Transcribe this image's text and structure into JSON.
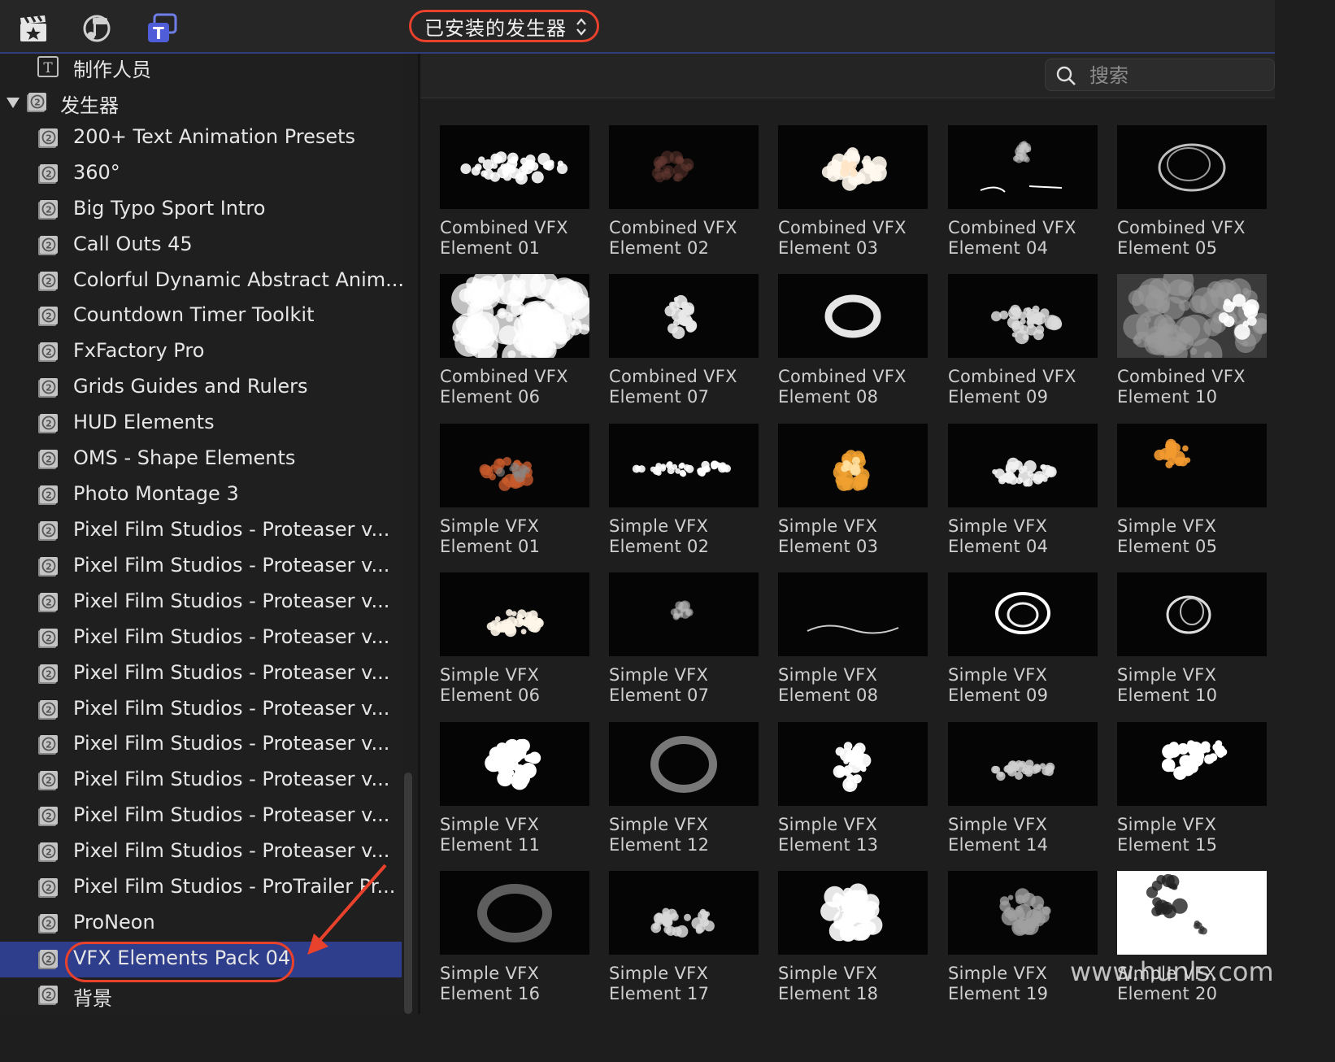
{
  "toolbar": {
    "icons": [
      "clapper-star-icon",
      "music-note-icon",
      "titles-T-icon"
    ],
    "popup_label": "已安装的发生器"
  },
  "sidebar": {
    "items": [
      {
        "label": "制作人员",
        "icon": "text-T-icon",
        "level": 1
      },
      {
        "label": "发生器",
        "icon": "generator-icon",
        "level": 0,
        "expanded": true
      },
      {
        "label": "200+ Text Animation Presets",
        "icon": "generator-icon",
        "level": 1
      },
      {
        "label": "360°",
        "icon": "generator-icon",
        "level": 1
      },
      {
        "label": "Big Typo Sport Intro",
        "icon": "generator-icon",
        "level": 1
      },
      {
        "label": "Call Outs 45",
        "icon": "generator-icon",
        "level": 1
      },
      {
        "label": "Colorful Dynamic Abstract Anim...",
        "icon": "generator-icon",
        "level": 1
      },
      {
        "label": "Countdown Timer Toolkit",
        "icon": "generator-icon",
        "level": 1
      },
      {
        "label": "FxFactory Pro",
        "icon": "generator-icon",
        "level": 1
      },
      {
        "label": "Grids Guides and Rulers",
        "icon": "generator-icon",
        "level": 1
      },
      {
        "label": "HUD Elements",
        "icon": "generator-icon",
        "level": 1
      },
      {
        "label": "OMS - Shape Elements",
        "icon": "generator-icon",
        "level": 1
      },
      {
        "label": "Photo Montage 3",
        "icon": "generator-icon",
        "level": 1
      },
      {
        "label": "Pixel Film Studios - Proteaser v...",
        "icon": "generator-icon",
        "level": 1
      },
      {
        "label": "Pixel Film Studios - Proteaser v...",
        "icon": "generator-icon",
        "level": 1
      },
      {
        "label": "Pixel Film Studios - Proteaser v...",
        "icon": "generator-icon",
        "level": 1
      },
      {
        "label": "Pixel Film Studios - Proteaser v...",
        "icon": "generator-icon",
        "level": 1
      },
      {
        "label": "Pixel Film Studios - Proteaser v...",
        "icon": "generator-icon",
        "level": 1
      },
      {
        "label": "Pixel Film Studios - Proteaser v...",
        "icon": "generator-icon",
        "level": 1
      },
      {
        "label": "Pixel Film Studios - Proteaser v...",
        "icon": "generator-icon",
        "level": 1
      },
      {
        "label": "Pixel Film Studios - Proteaser v...",
        "icon": "generator-icon",
        "level": 1
      },
      {
        "label": "Pixel Film Studios - Proteaser v...",
        "icon": "generator-icon",
        "level": 1
      },
      {
        "label": "Pixel Film Studios - Proteaser v...",
        "icon": "generator-icon",
        "level": 1
      },
      {
        "label": "Pixel Film Studios - ProTrailer Pr...",
        "icon": "generator-icon",
        "level": 1
      },
      {
        "label": "ProNeon",
        "icon": "generator-icon",
        "level": 1
      },
      {
        "label": "VFX Elements Pack 04",
        "icon": "generator-icon",
        "level": 1,
        "selected": true
      },
      {
        "label": "背景",
        "icon": "generator-icon",
        "level": 1
      }
    ]
  },
  "search": {
    "placeholder": "搜索"
  },
  "grid": {
    "tiles": [
      {
        "line1": "Combined VFX",
        "line2": "Element 01"
      },
      {
        "line1": "Combined VFX",
        "line2": "Element 02"
      },
      {
        "line1": "Combined VFX",
        "line2": "Element 03"
      },
      {
        "line1": "Combined VFX",
        "line2": "Element 04"
      },
      {
        "line1": "Combined VFX",
        "line2": "Element 05"
      },
      {
        "line1": "Combined VFX",
        "line2": "Element 06"
      },
      {
        "line1": "Combined VFX",
        "line2": "Element 07"
      },
      {
        "line1": "Combined VFX",
        "line2": "Element 08"
      },
      {
        "line1": "Combined VFX",
        "line2": "Element 09"
      },
      {
        "line1": "Combined VFX",
        "line2": "Element 10"
      },
      {
        "line1": "Simple VFX",
        "line2": "Element 01"
      },
      {
        "line1": "Simple VFX",
        "line2": "Element 02"
      },
      {
        "line1": "Simple VFX",
        "line2": "Element 03"
      },
      {
        "line1": "Simple VFX",
        "line2": "Element 04"
      },
      {
        "line1": "Simple VFX",
        "line2": "Element 05"
      },
      {
        "line1": "Simple VFX",
        "line2": "Element 06"
      },
      {
        "line1": "Simple VFX",
        "line2": "Element 07"
      },
      {
        "line1": "Simple VFX",
        "line2": "Element 08"
      },
      {
        "line1": "Simple VFX",
        "line2": "Element 09"
      },
      {
        "line1": "Simple VFX",
        "line2": "Element 10"
      },
      {
        "line1": "Simple VFX",
        "line2": "Element 11"
      },
      {
        "line1": "Simple VFX",
        "line2": "Element 12"
      },
      {
        "line1": "Simple VFX",
        "line2": "Element 13"
      },
      {
        "line1": "Simple VFX",
        "line2": "Element 14"
      },
      {
        "line1": "Simple VFX",
        "line2": "Element 15"
      },
      {
        "line1": "Simple VFX",
        "line2": "Element 16"
      },
      {
        "line1": "Simple VFX",
        "line2": "Element 17"
      },
      {
        "line1": "Simple VFX",
        "line2": "Element 18"
      },
      {
        "line1": "Simple VFX",
        "line2": "Element 19"
      },
      {
        "line1": "Simple VFX",
        "line2": "Element 20"
      }
    ]
  },
  "watermark": "www.hunls.com",
  "colors": {
    "selection": "#2e3d8c",
    "highlight_ring": "#e8412c",
    "background": "#1e1e1e"
  }
}
